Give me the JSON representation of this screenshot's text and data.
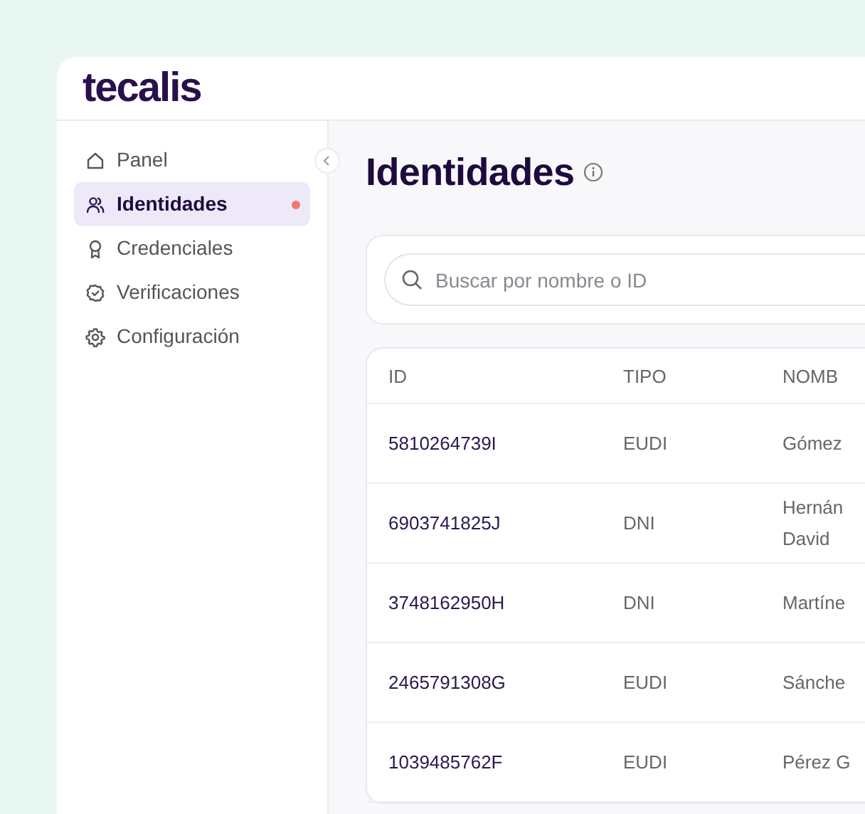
{
  "header": {
    "logo": "tecalis"
  },
  "sidebar": {
    "items": [
      {
        "label": "Panel",
        "kind": "home",
        "selected": false,
        "dot": false
      },
      {
        "label": "Identidades",
        "kind": "users",
        "selected": true,
        "dot": true
      },
      {
        "label": "Credenciales",
        "kind": "award",
        "selected": false,
        "dot": false
      },
      {
        "label": "Verificaciones",
        "kind": "badge",
        "selected": false,
        "dot": false
      },
      {
        "label": "Configuración",
        "kind": "gear",
        "selected": false,
        "dot": false
      }
    ]
  },
  "page": {
    "title": "Identidades"
  },
  "search": {
    "placeholder": "Buscar por nombre o ID"
  },
  "table": {
    "columns": [
      "ID",
      "TIPO",
      "NOMB"
    ],
    "rows": [
      {
        "id": "5810264739I",
        "type": "EUDI",
        "name": [
          "Gómez"
        ]
      },
      {
        "id": "6903741825J",
        "type": "DNI",
        "name": [
          "Hernán",
          "David"
        ]
      },
      {
        "id": "3748162950H",
        "type": "DNI",
        "name": [
          "Martíne"
        ]
      },
      {
        "id": "2465791308G",
        "type": "EUDI",
        "name": [
          "Sánche"
        ]
      },
      {
        "id": "1039485762F",
        "type": "EUDI",
        "name": [
          "Pérez G"
        ]
      }
    ]
  }
}
